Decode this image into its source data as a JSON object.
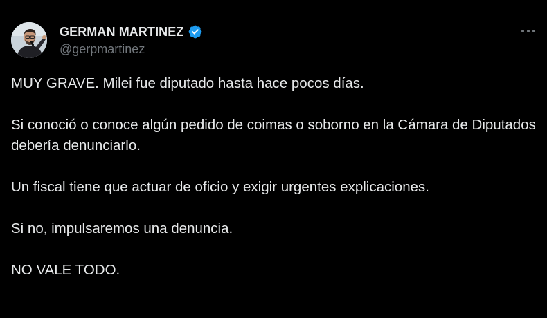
{
  "author": {
    "display_name": "GERMAN MARTINEZ",
    "handle": "@gerpmartinez",
    "verified_color": "#1d9bf0",
    "avatar_icon": "profile-photo"
  },
  "menu": {
    "more_icon": "more-horizontal-icon"
  },
  "tweet": {
    "paragraphs": [
      "MUY GRAVE. Milei fue diputado hasta hace pocos días.",
      "Si conoció o conoce algún pedido de coimas o soborno en la Cámara de Diputados debería denunciarlo.",
      "Un fiscal tiene que actuar de oficio y exigir urgentes explicaciones.",
      "Si no, impulsaremos una denuncia.",
      "NO VALE TODO."
    ]
  },
  "colors": {
    "background": "#000000",
    "text": "#e7e9ea",
    "muted": "#71767b"
  }
}
